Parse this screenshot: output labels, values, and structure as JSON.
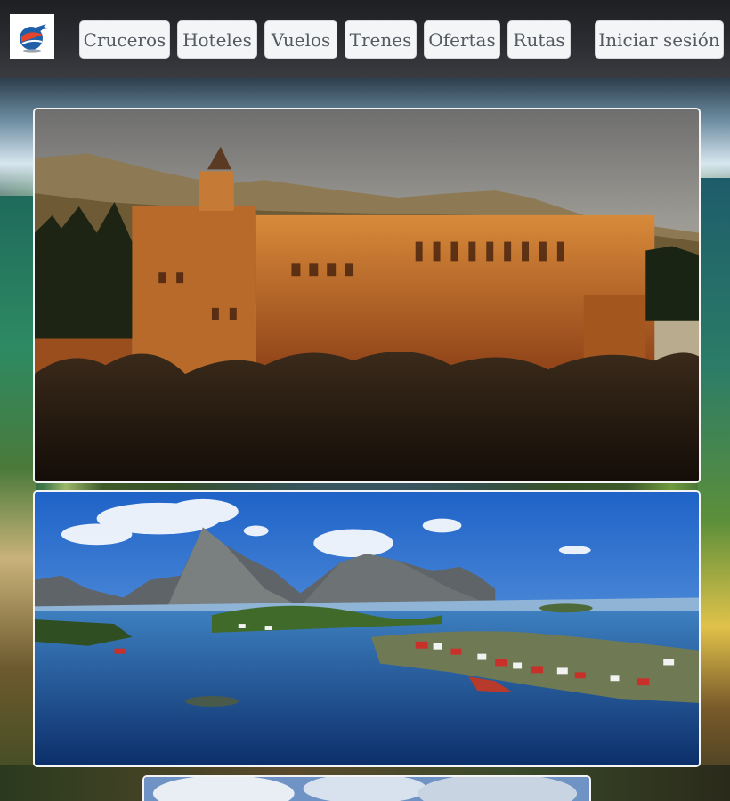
{
  "navbar": {
    "logo_icon": "globe-plane-icon",
    "items": [
      {
        "label": "Cruceros"
      },
      {
        "label": "Hoteles"
      },
      {
        "label": "Vuelos"
      },
      {
        "label": "Trenes"
      },
      {
        "label": "Ofertas"
      },
      {
        "label": "Rutas"
      }
    ],
    "login_label": "Iniciar sesión"
  },
  "gallery": {
    "images": [
      {
        "subject": "alhambra-palace-photo"
      },
      {
        "subject": "lofoten-fjord-village-photo"
      },
      {
        "subject": "sky-clouds-photo"
      }
    ]
  },
  "colors": {
    "navbar_bg": "#1e1f22",
    "button_bg": "#f4f5f7",
    "button_text": "#555a60",
    "card_border": "#f4f4f4"
  }
}
